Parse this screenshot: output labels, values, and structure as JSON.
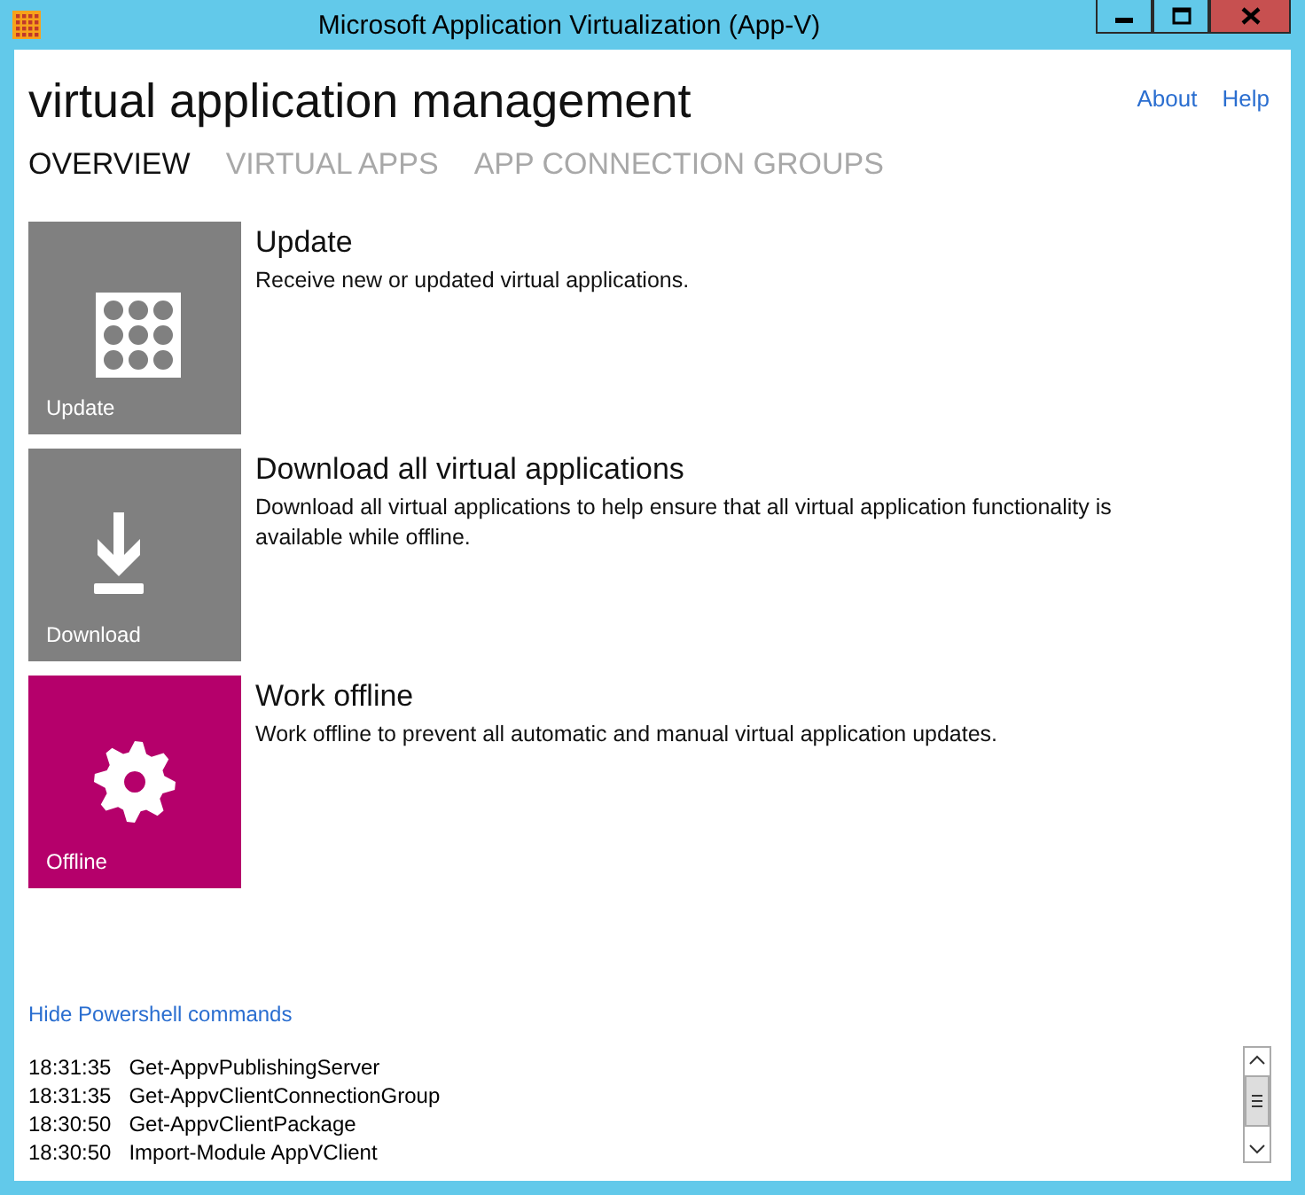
{
  "window": {
    "title": "Microsoft Application Virtualization (App-V)"
  },
  "header": {
    "title": "virtual application management",
    "links": [
      "About",
      "Help"
    ]
  },
  "tabs": [
    {
      "label": "OVERVIEW",
      "selected": true
    },
    {
      "label": "VIRTUAL APPS",
      "selected": false
    },
    {
      "label": "APP CONNECTION GROUPS",
      "selected": false
    }
  ],
  "actions": [
    {
      "kind": "grid",
      "tile_label": "Update",
      "color": "#808080",
      "title": "Update",
      "description": "Receive new or updated virtual applications."
    },
    {
      "kind": "download",
      "tile_label": "Download",
      "color": "#808080",
      "title": "Download all virtual applications",
      "description": "Download all virtual applications to help ensure that all virtual application functionality is available while offline."
    },
    {
      "kind": "gear",
      "tile_label": "Offline",
      "color": "#b5006b",
      "title": "Work offline",
      "description": "Work offline to prevent all automatic and manual virtual application updates."
    }
  ],
  "powershell": {
    "toggle": "Hide Powershell commands",
    "log": [
      {
        "time": "18:31:35",
        "command": "Get-AppvPublishingServer"
      },
      {
        "time": "18:31:35",
        "command": "Get-AppvClientConnectionGroup"
      },
      {
        "time": "18:30:50",
        "command": "Get-AppvClientPackage"
      },
      {
        "time": "18:30:50",
        "command": "Import-Module AppVClient"
      }
    ]
  }
}
